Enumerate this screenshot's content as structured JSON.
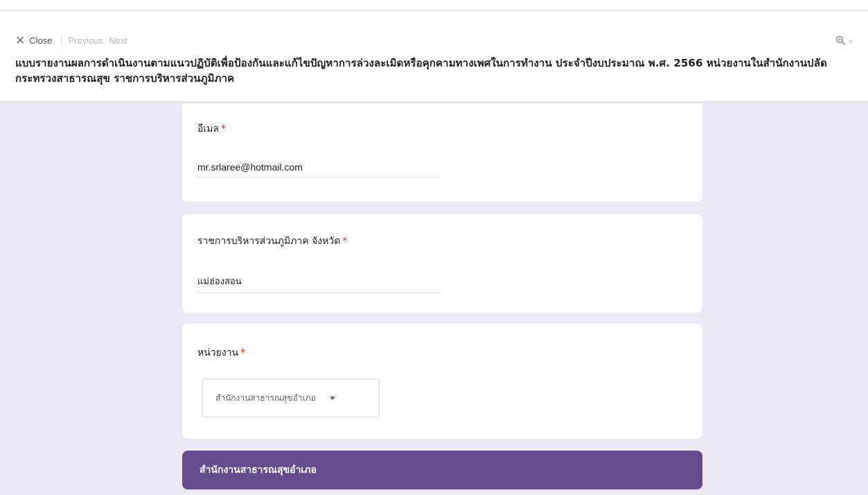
{
  "toolbar": {
    "close_label": "Close",
    "previous_label": "Previous",
    "next_label": "Next"
  },
  "form": {
    "title": "แบบรายงานผลการดำเนินงานตามแนวปฏิบัติเพื่อป้องกันและแก้ไขปัญหาการล่วงละเมิดหรือคุกคามทางเพศในการทำงาน ประจำปีงบประมาณ พ.ศ. 2566 หน่วยงานในสำนักงานปลัดกระทรวงสาธารณสุข ราชการบริหารส่วนภูมิภาค",
    "questions": [
      {
        "label": "อีเมล",
        "required_mark": "*",
        "answer": "mr.srlaree@hotmail.com"
      },
      {
        "label": "ราชการบริหารส่วนภูมิภาค จังหวัด",
        "required_mark": "*",
        "answer": "แม่ฮ่องสอน"
      },
      {
        "label": "หน่วยงาน",
        "required_mark": "*",
        "selected_option": "สำนักงานสาธารณสุขอำเภอ"
      }
    ],
    "section_header": "สำนักงานสาธารณสุขอำเภอ"
  },
  "colors": {
    "accent": "#644c8e",
    "background": "#ede8f5",
    "required": "#d93025"
  },
  "icons": {
    "close": "close-icon",
    "zoom": "zoom-in-icon",
    "dropdown": "dropdown-arrow-icon"
  }
}
